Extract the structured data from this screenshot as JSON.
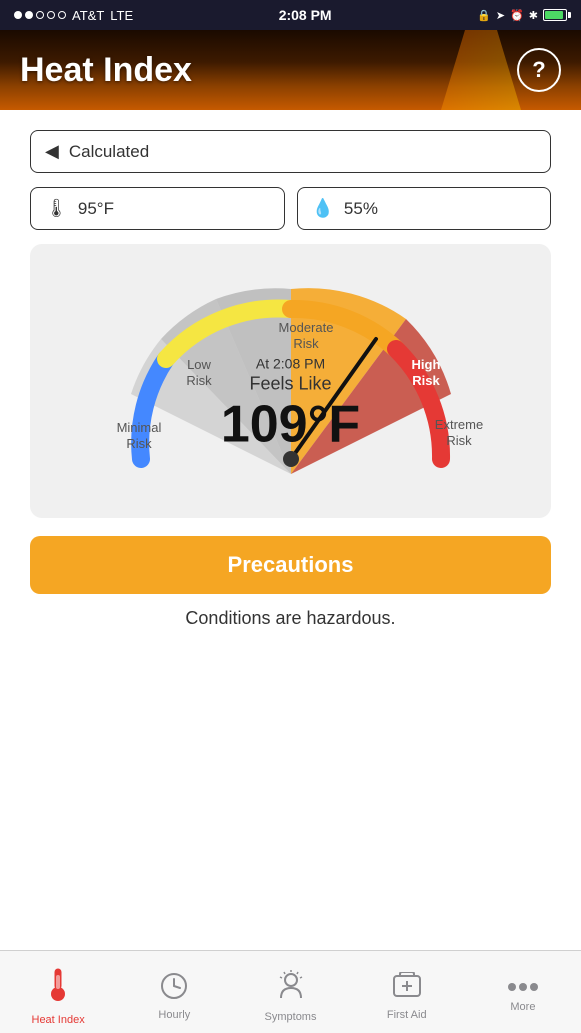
{
  "statusBar": {
    "carrier": "AT&T",
    "network": "LTE",
    "time": "2:08 PM"
  },
  "header": {
    "title": "Heat Index",
    "helpLabel": "?"
  },
  "inputs": {
    "location": {
      "placeholder": "Calculated",
      "value": "Calculated",
      "icon": "▶"
    },
    "temperature": {
      "value": "95°F"
    },
    "humidity": {
      "value": "55%"
    }
  },
  "gauge": {
    "time": "At 2:08 PM",
    "feelsLike": "Feels Like",
    "temperature": "109°F",
    "riskLabels": {
      "minimal": "Minimal Risk",
      "low": "Low Risk",
      "moderate": "Moderate Risk",
      "high": "High Risk",
      "extreme": "Extreme Risk"
    }
  },
  "precautions": {
    "label": "Precautions"
  },
  "conditions": {
    "text": "Conditions are hazardous."
  },
  "tabs": [
    {
      "id": "heat-index",
      "label": "Heat Index",
      "active": true
    },
    {
      "id": "hourly",
      "label": "Hourly",
      "active": false
    },
    {
      "id": "symptoms",
      "label": "Symptoms",
      "active": false
    },
    {
      "id": "first-aid",
      "label": "First Aid",
      "active": false
    },
    {
      "id": "more",
      "label": "More",
      "active": false
    }
  ]
}
